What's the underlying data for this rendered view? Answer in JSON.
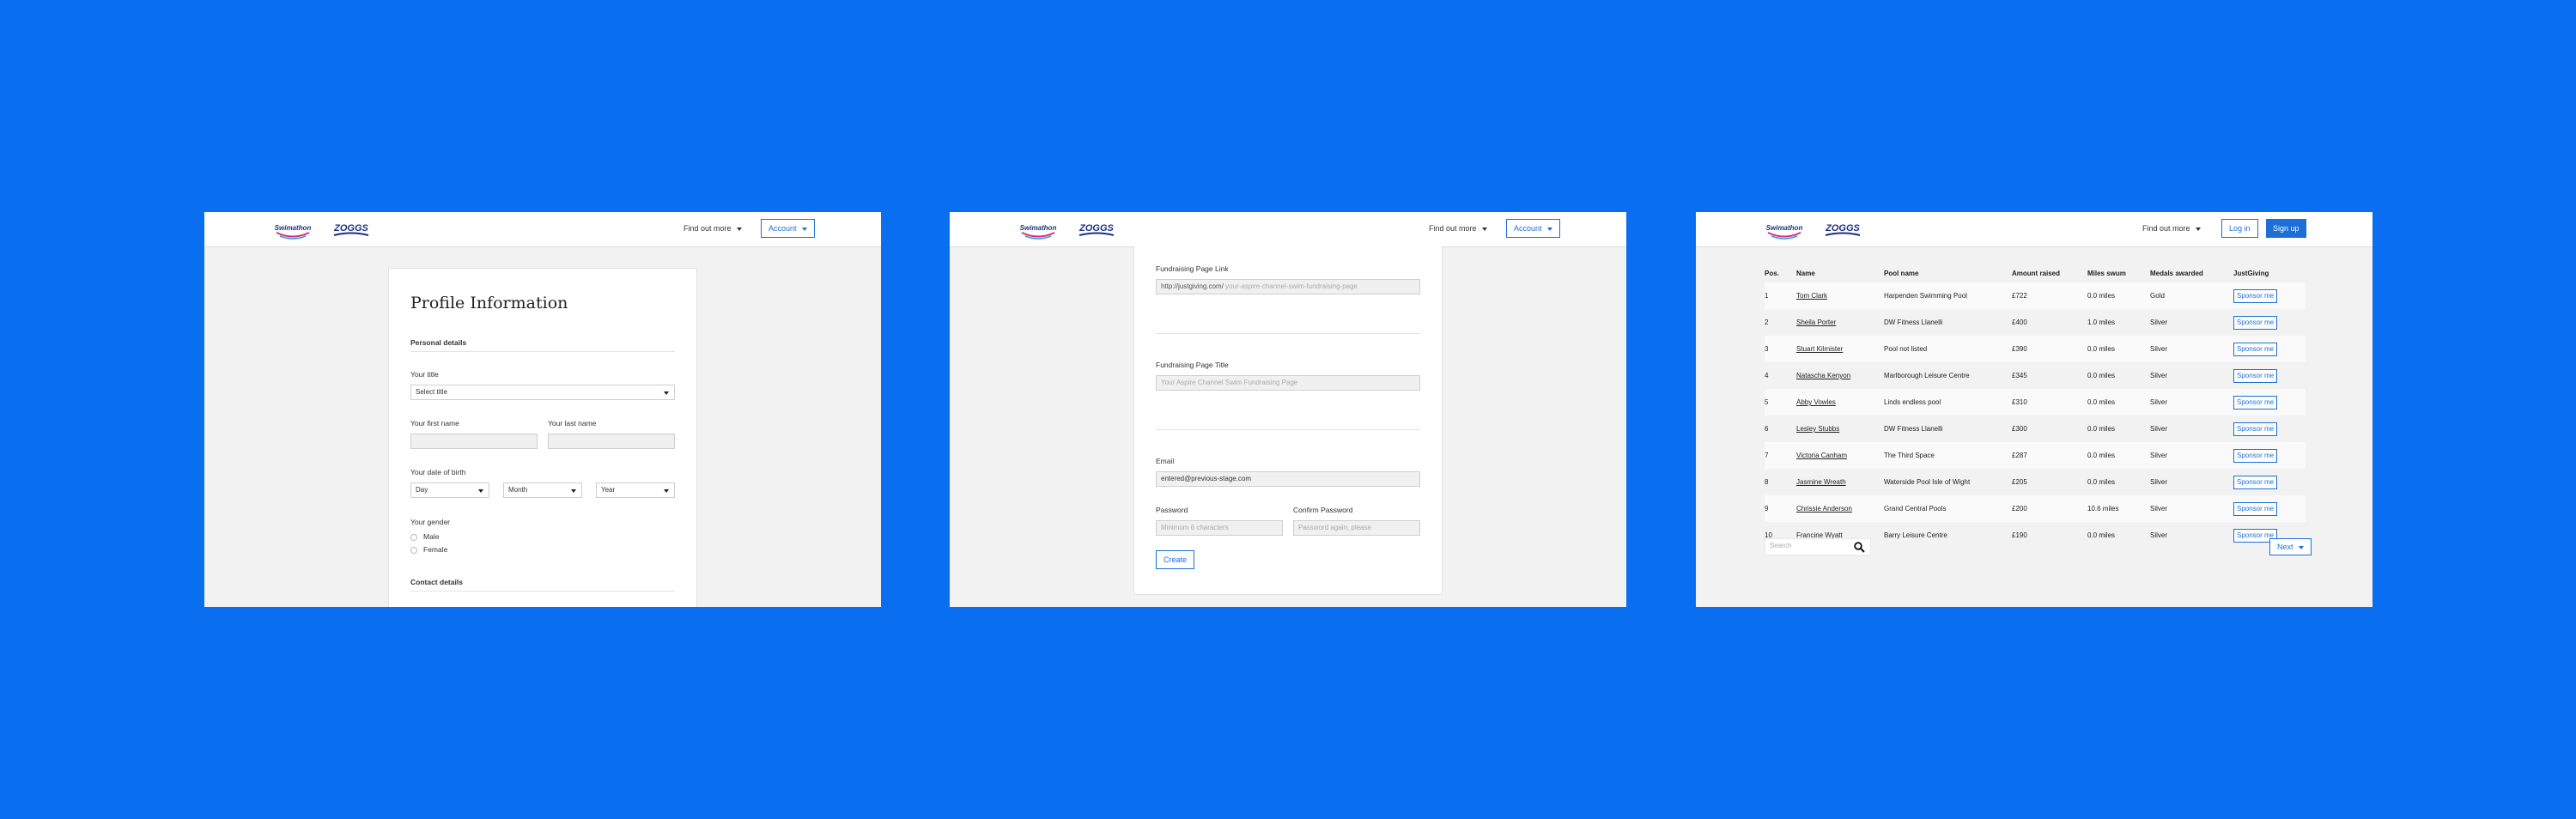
{
  "panel1": {
    "nav": {
      "logo1": "Swimathon",
      "logo2": "ZOGGS",
      "find_out_more": "Find out more",
      "account": "Account"
    },
    "title": "Profile Information",
    "personal_heading": "Personal details",
    "your_title_label": "Your title",
    "title_select": "Select title",
    "first_name_label": "Your first name",
    "last_name_label": "Your last name",
    "dob_label": "Your date of birth",
    "day": "Day",
    "month": "Month",
    "year": "Year",
    "gender_label": "Your gender",
    "male": "Male",
    "female": "Female",
    "contact_heading": "Contact details"
  },
  "panel2": {
    "nav": {
      "logo1": "Swimathon",
      "logo2": "ZOGGS",
      "find_out_more": "Find out more",
      "account": "Account"
    },
    "link_label": "Fundraising Page Link",
    "link_prefix": "http://justgiving.com/",
    "link_placeholder": "your-aspire-channel-swim-fundraising-page",
    "page_title_label": "Fundraising Page Title",
    "page_title_placeholder": "Your Aspire Channel Swim Fundraising Page",
    "email_label": "Email",
    "email_value": "entered@previous-stage.com",
    "password_label": "Password",
    "password_placeholder": "Minimum 6 characters",
    "confirm_label": "Confirm Password",
    "confirm_placeholder": "Password again, please",
    "create_button": "Create"
  },
  "panel3": {
    "nav": {
      "logo1": "Swimathon",
      "logo2": "ZOGGS",
      "find_out_more": "Find out more",
      "login": "Log in",
      "signup": "Sign up"
    },
    "headers": [
      "Pos.",
      "Name",
      "Pool name",
      "Amount raised",
      "Miles swum",
      "Medals awarded",
      "JustGiving"
    ],
    "rows": [
      [
        "1",
        "Tom Clark",
        "Harpenden Swimming Pool",
        "£722",
        "0.0 miles",
        "Gold",
        "Sponsor me"
      ],
      [
        "2",
        "Sheila Porter",
        "DW Fitness Llanelli",
        "£400",
        "1.0 miles",
        "Silver",
        "Sponsor me"
      ],
      [
        "3",
        "Stuart Kilmister",
        "Pool not listed",
        "£390",
        "0.0 miles",
        "Silver",
        "Sponsor me"
      ],
      [
        "4",
        "Natascha Kenyon",
        "Marlborough Leisure Centre",
        "£345",
        "0.0 miles",
        "Silver",
        "Sponsor me"
      ],
      [
        "5",
        "Abby Vowles",
        "Linds endless pool",
        "£310",
        "0.0 miles",
        "Silver",
        "Sponsor me"
      ],
      [
        "6",
        "Lesley Stubbs",
        "DW Fitness Llanelli",
        "£300",
        "0.0 miles",
        "Silver",
        "Sponsor me"
      ],
      [
        "7",
        "Victoria Canham",
        "The Third Space",
        "£287",
        "0.0 miles",
        "Silver",
        "Sponsor me"
      ],
      [
        "8",
        "Jasmine Wreath",
        "Waterside Pool Isle of Wight",
        "£205",
        "0.0 miles",
        "Silver",
        "Sponsor me"
      ],
      [
        "9",
        "Chrissie Anderson",
        "Grand Central Pools",
        "£200",
        "10.6 miles",
        "Silver",
        "Sponsor me"
      ],
      [
        "10",
        "Francine Wyatt",
        "Barry Leisure Centre",
        "£190",
        "0.0 miles",
        "Silver",
        "Sponsor me"
      ]
    ],
    "search_placeholder": "Search",
    "next_button": "Next"
  }
}
